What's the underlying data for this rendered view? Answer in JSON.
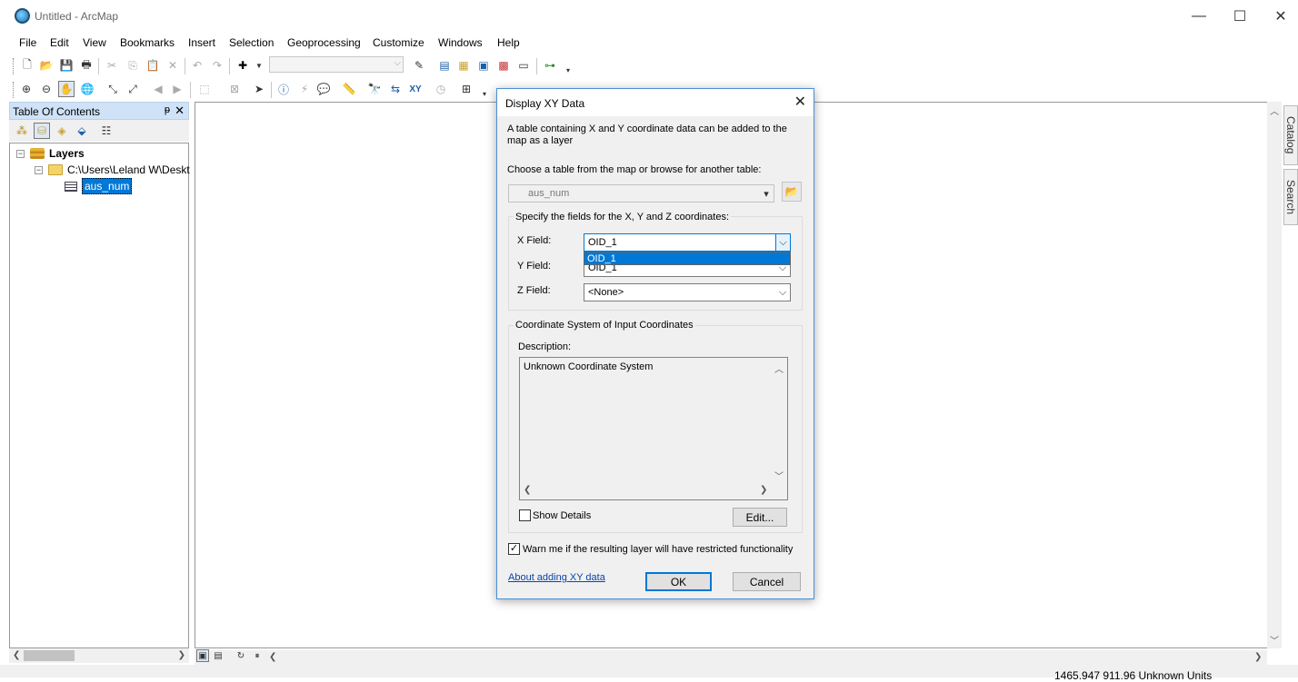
{
  "window": {
    "title": "Untitled - ArcMap",
    "minimize": "—",
    "maximize": "☐",
    "close": "✕"
  },
  "menu": [
    "File",
    "Edit",
    "View",
    "Bookmarks",
    "Insert",
    "Selection",
    "Geoprocessing",
    "Customize",
    "Windows",
    "Help"
  ],
  "toc": {
    "title": "Table Of Contents",
    "pin": "ᵽ",
    "close": "✕",
    "tree": {
      "root": "Layers",
      "folder": "C:\\Users\\Leland W\\Deskt",
      "table": "aus_num",
      "collapse_symbol": "−"
    }
  },
  "side_tabs": [
    "Catalog",
    "Search"
  ],
  "status": {
    "coordinates": "1465.947  911.96 Unknown Units"
  },
  "dialog": {
    "title": "Display XY Data",
    "close": "✕",
    "intro_line1": "A table containing X and Y coordinate data can be added to the",
    "intro_line2": "map as a layer",
    "choose_label": "Choose a table from the map or browse for another table:",
    "table_value": "aus_num",
    "fields_group": "Specify the fields for the X, Y and Z coordinates:",
    "x_label": "X Field:",
    "x_value": "OID_1",
    "x_dropdown_option": "OID_1",
    "y_label": "Y Field:",
    "y_value": "OID_1",
    "z_label": "Z Field:",
    "z_value": "<None>",
    "coord_group": "Coordinate System of Input Coordinates",
    "description_label": "Description:",
    "description_value": "Unknown Coordinate System",
    "show_details": "Show Details",
    "edit_button": "Edit...",
    "warn_label": "Warn me if the resulting layer will have restricted functionality",
    "warn_checked": "✓",
    "about_link": "About adding XY data",
    "ok_button": "OK",
    "cancel_button": "Cancel"
  },
  "toolbar1_icons": [
    "new-document-icon",
    "open-icon",
    "save-icon",
    "print-icon",
    "cut-icon",
    "copy-icon",
    "paste-icon",
    "delete-icon",
    "undo-icon",
    "redo-icon",
    "add-data-icon"
  ],
  "toolbar2_icons": [
    "zoom-in-icon",
    "zoom-out-icon",
    "pan-icon",
    "full-extent-icon",
    "fixed-zoom-in-icon",
    "fixed-zoom-out-icon",
    "back-icon",
    "forward-icon",
    "select-icon",
    "identify-icon",
    "find-icon",
    "go-to-xy-icon"
  ]
}
